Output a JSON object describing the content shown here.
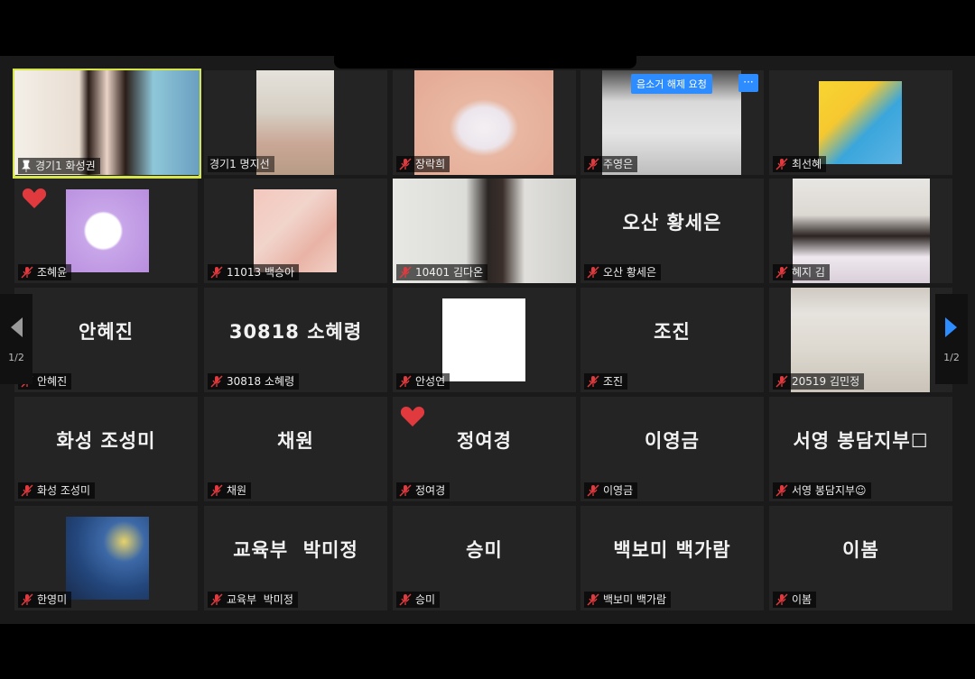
{
  "colors": {
    "active_border": "#d6e54a",
    "heart": "#e0393e",
    "mute_red": "#e0393e",
    "accent_blue": "#2d8cff"
  },
  "nav": {
    "prev_page": "1/2",
    "next_page": "1/2"
  },
  "remote_control": {
    "unmute_request": "음소거 해제 요청",
    "more": "···"
  },
  "tiles": [
    {
      "name": "경기1 화성권"
    },
    {
      "name": "경기1 명지선"
    },
    {
      "name": "장락희"
    },
    {
      "name": "주영은"
    },
    {
      "name": "최선혜"
    },
    {
      "name": "조혜윤"
    },
    {
      "name": "11013 백승아"
    },
    {
      "name": "10401 김다온"
    },
    {
      "display": "오산 황세은",
      "name": "오산 황세은"
    },
    {
      "name": "혜지 김"
    },
    {
      "display": "안혜진",
      "name": "안혜진"
    },
    {
      "display": "30818 소혜령",
      "name": "30818 소혜령"
    },
    {
      "name": "안성연"
    },
    {
      "display": "조진",
      "name": "조진"
    },
    {
      "name": "20519 김민정"
    },
    {
      "display": "화성 조성미",
      "name": "화성 조성미"
    },
    {
      "display": "채원",
      "name": "채원"
    },
    {
      "display": "정여경",
      "name": "정여경"
    },
    {
      "display": "이영금",
      "name": "이영금"
    },
    {
      "display": "서영 봉담지부☐",
      "name": "서영 봉담지부☺"
    },
    {
      "name": "한영미"
    },
    {
      "display": "교육부  박미정",
      "name": "교육부  박미정"
    },
    {
      "display": "승미",
      "name": "승미"
    },
    {
      "display": "백보미 백가람",
      "name": "백보미 백가람"
    },
    {
      "display": "이봄",
      "name": "이봄"
    }
  ]
}
